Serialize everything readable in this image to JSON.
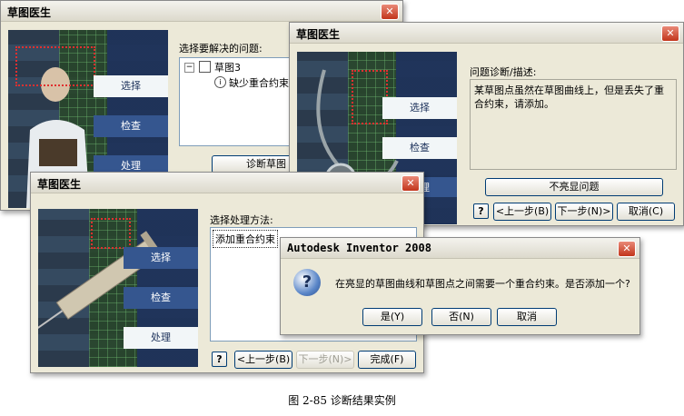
{
  "window1": {
    "title": "草图医生",
    "steps": [
      "选择",
      "检查",
      "处理"
    ],
    "question_label": "选择要解决的问题:",
    "tree": {
      "root": "草图3",
      "child": "缺少重合约束"
    },
    "diagnose_button": "诊断草图"
  },
  "window2": {
    "title": "草图医生",
    "steps": [
      "选择",
      "检查",
      "处理"
    ],
    "desc_label": "问题诊断/描述:",
    "desc_text": "某草图点虽然在草图曲线上，但是丢失了重合约束，请添加。",
    "highlight_button": "不亮显问题",
    "help_label": "?",
    "back_button": "<上一步(B)",
    "next_button": "下一步(N)>",
    "cancel_button": "取消(C)"
  },
  "window3": {
    "title": "草图医生",
    "steps": [
      "选择",
      "检查",
      "处理"
    ],
    "method_label": "选择处理方法:",
    "method_item": "添加重合约束",
    "help_label": "?",
    "back_button": "<上一步(B)",
    "next_button": "下一步(N)>",
    "finish_button": "完成(F)"
  },
  "dialog": {
    "title": "Autodesk Inventor 2008",
    "message": "在亮显的草图曲线和草图点之间需要一个重合约束。是否添加一个?",
    "yes_button": "是(Y)",
    "no_button": "否(N)",
    "cancel_button": "取消",
    "icon": "question-icon"
  },
  "caption": "图 2-85  诊断结果实例",
  "close_glyph": "✕"
}
